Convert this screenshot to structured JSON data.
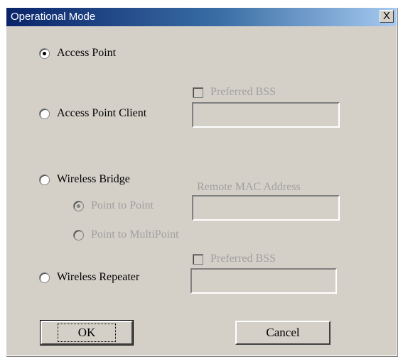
{
  "window": {
    "title": "Operational Mode",
    "close_label": "X"
  },
  "modes": [
    {
      "label": "Access Point",
      "checked": true,
      "enabled": true
    },
    {
      "label": "Access Point Client",
      "checked": false,
      "enabled": true
    },
    {
      "label": "Wireless Bridge",
      "checked": false,
      "enabled": true
    },
    {
      "label": "Wireless Repeater",
      "checked": false,
      "enabled": true
    }
  ],
  "bridge_options": [
    {
      "label": "Point to Point",
      "checked": true,
      "enabled": false
    },
    {
      "label": "Point to MultiPoint",
      "checked": false,
      "enabled": false
    }
  ],
  "client": {
    "preferred_bss_label": "Preferred BSS",
    "preferred_bss_checked": false,
    "bss_value": ""
  },
  "bridge": {
    "remote_mac_label": "Remote MAC Address",
    "remote_mac_value": ""
  },
  "repeater": {
    "preferred_bss_label": "Preferred BSS",
    "preferred_bss_checked": false,
    "bss_value": ""
  },
  "buttons": {
    "ok_label": "OK",
    "cancel_label": "Cancel"
  }
}
